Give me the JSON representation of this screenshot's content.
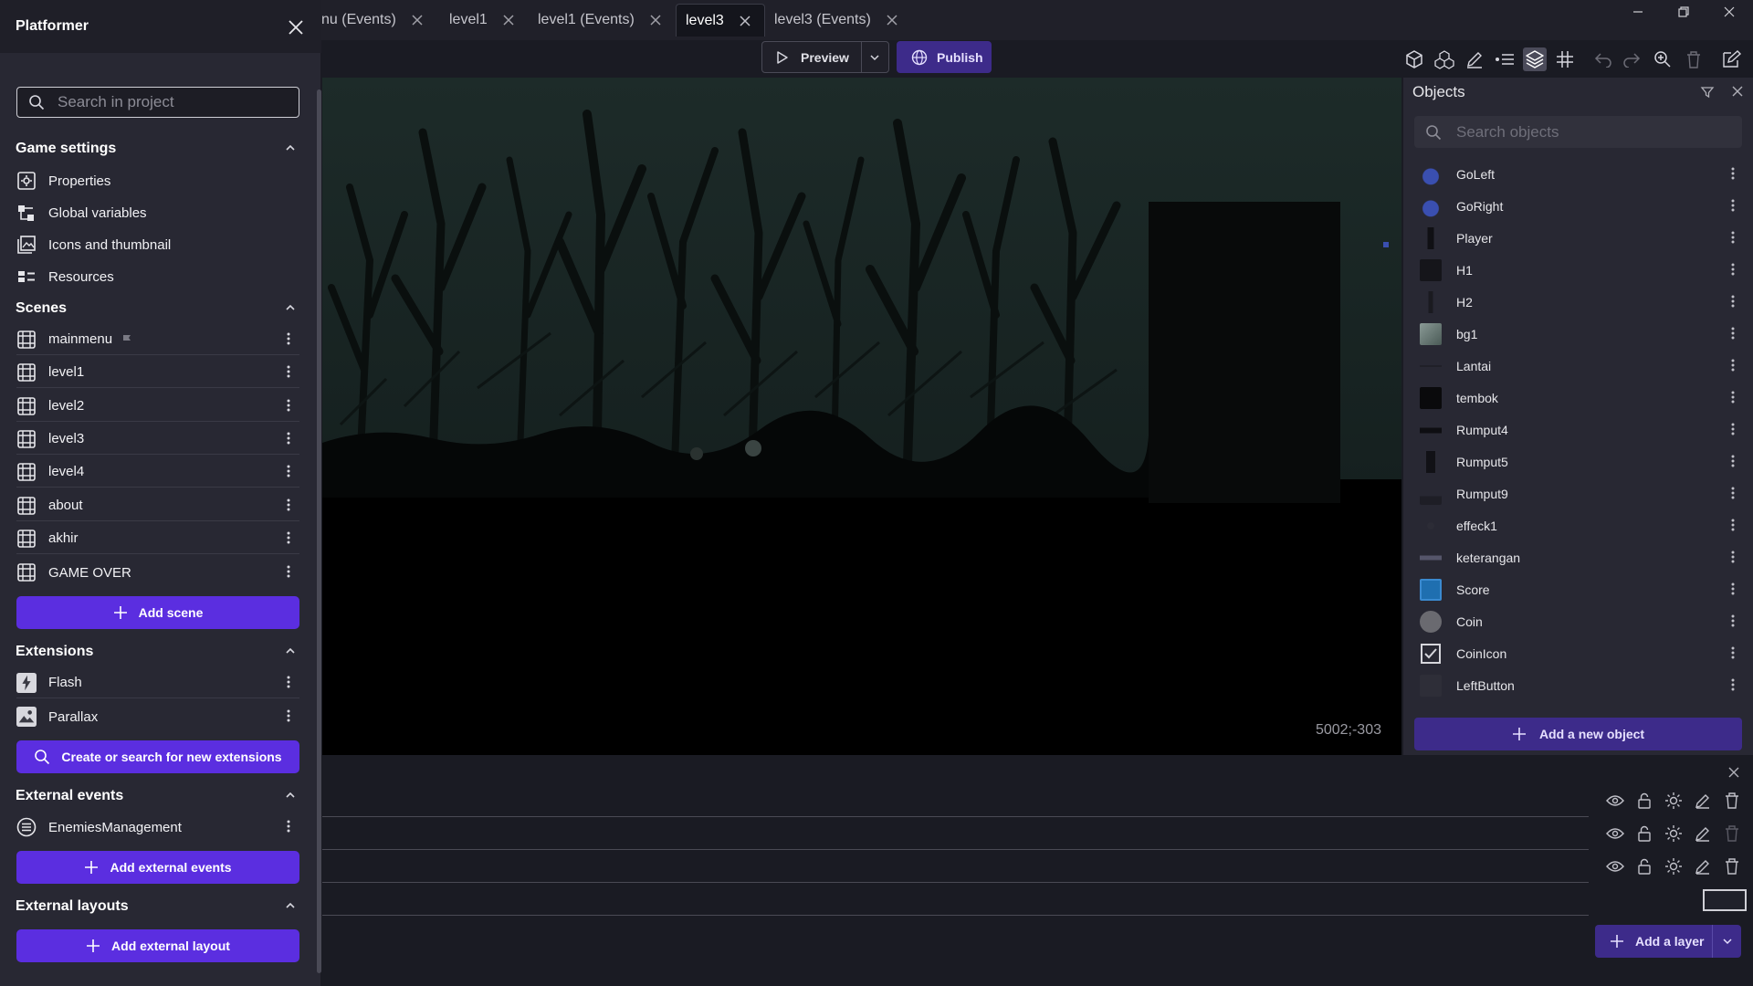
{
  "project": {
    "name": "Platformer",
    "search_placeholder": "Search in project"
  },
  "tabs": [
    {
      "label": "nu (Events)",
      "active": false
    },
    {
      "label": "level1",
      "active": false
    },
    {
      "label": "level1 (Events)",
      "active": false
    },
    {
      "label": "level3",
      "active": true
    },
    {
      "label": "level3 (Events)",
      "active": false
    }
  ],
  "game_settings": {
    "title": "Game settings",
    "items": [
      {
        "label": "Properties",
        "icon": "gear-icon"
      },
      {
        "label": "Global variables",
        "icon": "variables-icon"
      },
      {
        "label": "Icons and thumbnail",
        "icon": "image-icon"
      },
      {
        "label": "Resources",
        "icon": "resources-icon"
      }
    ]
  },
  "scenes": {
    "title": "Scenes",
    "items": [
      "mainmenu",
      "level1",
      "level2",
      "level3",
      "level4",
      "about",
      "akhir",
      "GAME OVER"
    ],
    "first_scene_badge": "flag-icon",
    "add_label": "Add scene"
  },
  "extensions": {
    "title": "Extensions",
    "items": [
      "Flash",
      "Parallax"
    ],
    "search_label": "Create or search for new extensions"
  },
  "external_events": {
    "title": "External events",
    "items": [
      "EnemiesManagement"
    ],
    "add_label": "Add external events"
  },
  "external_layouts": {
    "title": "External layouts",
    "add_label": "Add external layout"
  },
  "toolbar": {
    "preview_label": "Preview",
    "publish_label": "Publish",
    "icons": [
      "objects-3d-icon",
      "object-groups-icon",
      "edit-properties-icon",
      "instances-list-icon",
      "layers-icon",
      "grid-icon",
      "undo-icon",
      "redo-icon",
      "zoom-icon",
      "delete-icon",
      "settings-edit-icon"
    ]
  },
  "canvas": {
    "coordinates": "5002;-303"
  },
  "objects": {
    "title": "Objects",
    "search_placeholder": "Search objects",
    "items": [
      {
        "name": "GoLeft",
        "color": "#3a4fb0"
      },
      {
        "name": "GoRight",
        "color": "#3a4fb0"
      },
      {
        "name": "Player",
        "color": "#101014"
      },
      {
        "name": "H1",
        "color": "#15151a"
      },
      {
        "name": "H2",
        "color": "#1a1a20"
      },
      {
        "name": "bg1",
        "color": "#6a7a76"
      },
      {
        "name": "Lantai",
        "color": "#202028"
      },
      {
        "name": "tembok",
        "color": "#0a0a0c"
      },
      {
        "name": "Rumput4",
        "color": "#0e0e12"
      },
      {
        "name": "Rumput5",
        "color": "#111116"
      },
      {
        "name": "Rumput9",
        "color": "#1e1e26"
      },
      {
        "name": "effeck1",
        "color": "#2c2c36"
      },
      {
        "name": "keterangan",
        "color": "#55556a"
      },
      {
        "name": "Score",
        "color": "#1f6fb0"
      },
      {
        "name": "Coin",
        "color": "#6a6a70"
      },
      {
        "name": "CoinIcon",
        "color": "#d6d6dc"
      },
      {
        "name": "LeftButton",
        "color": "#2e2e38"
      }
    ],
    "add_label": "Add a new object"
  },
  "layers": {
    "add_label": "Add a layer"
  }
}
